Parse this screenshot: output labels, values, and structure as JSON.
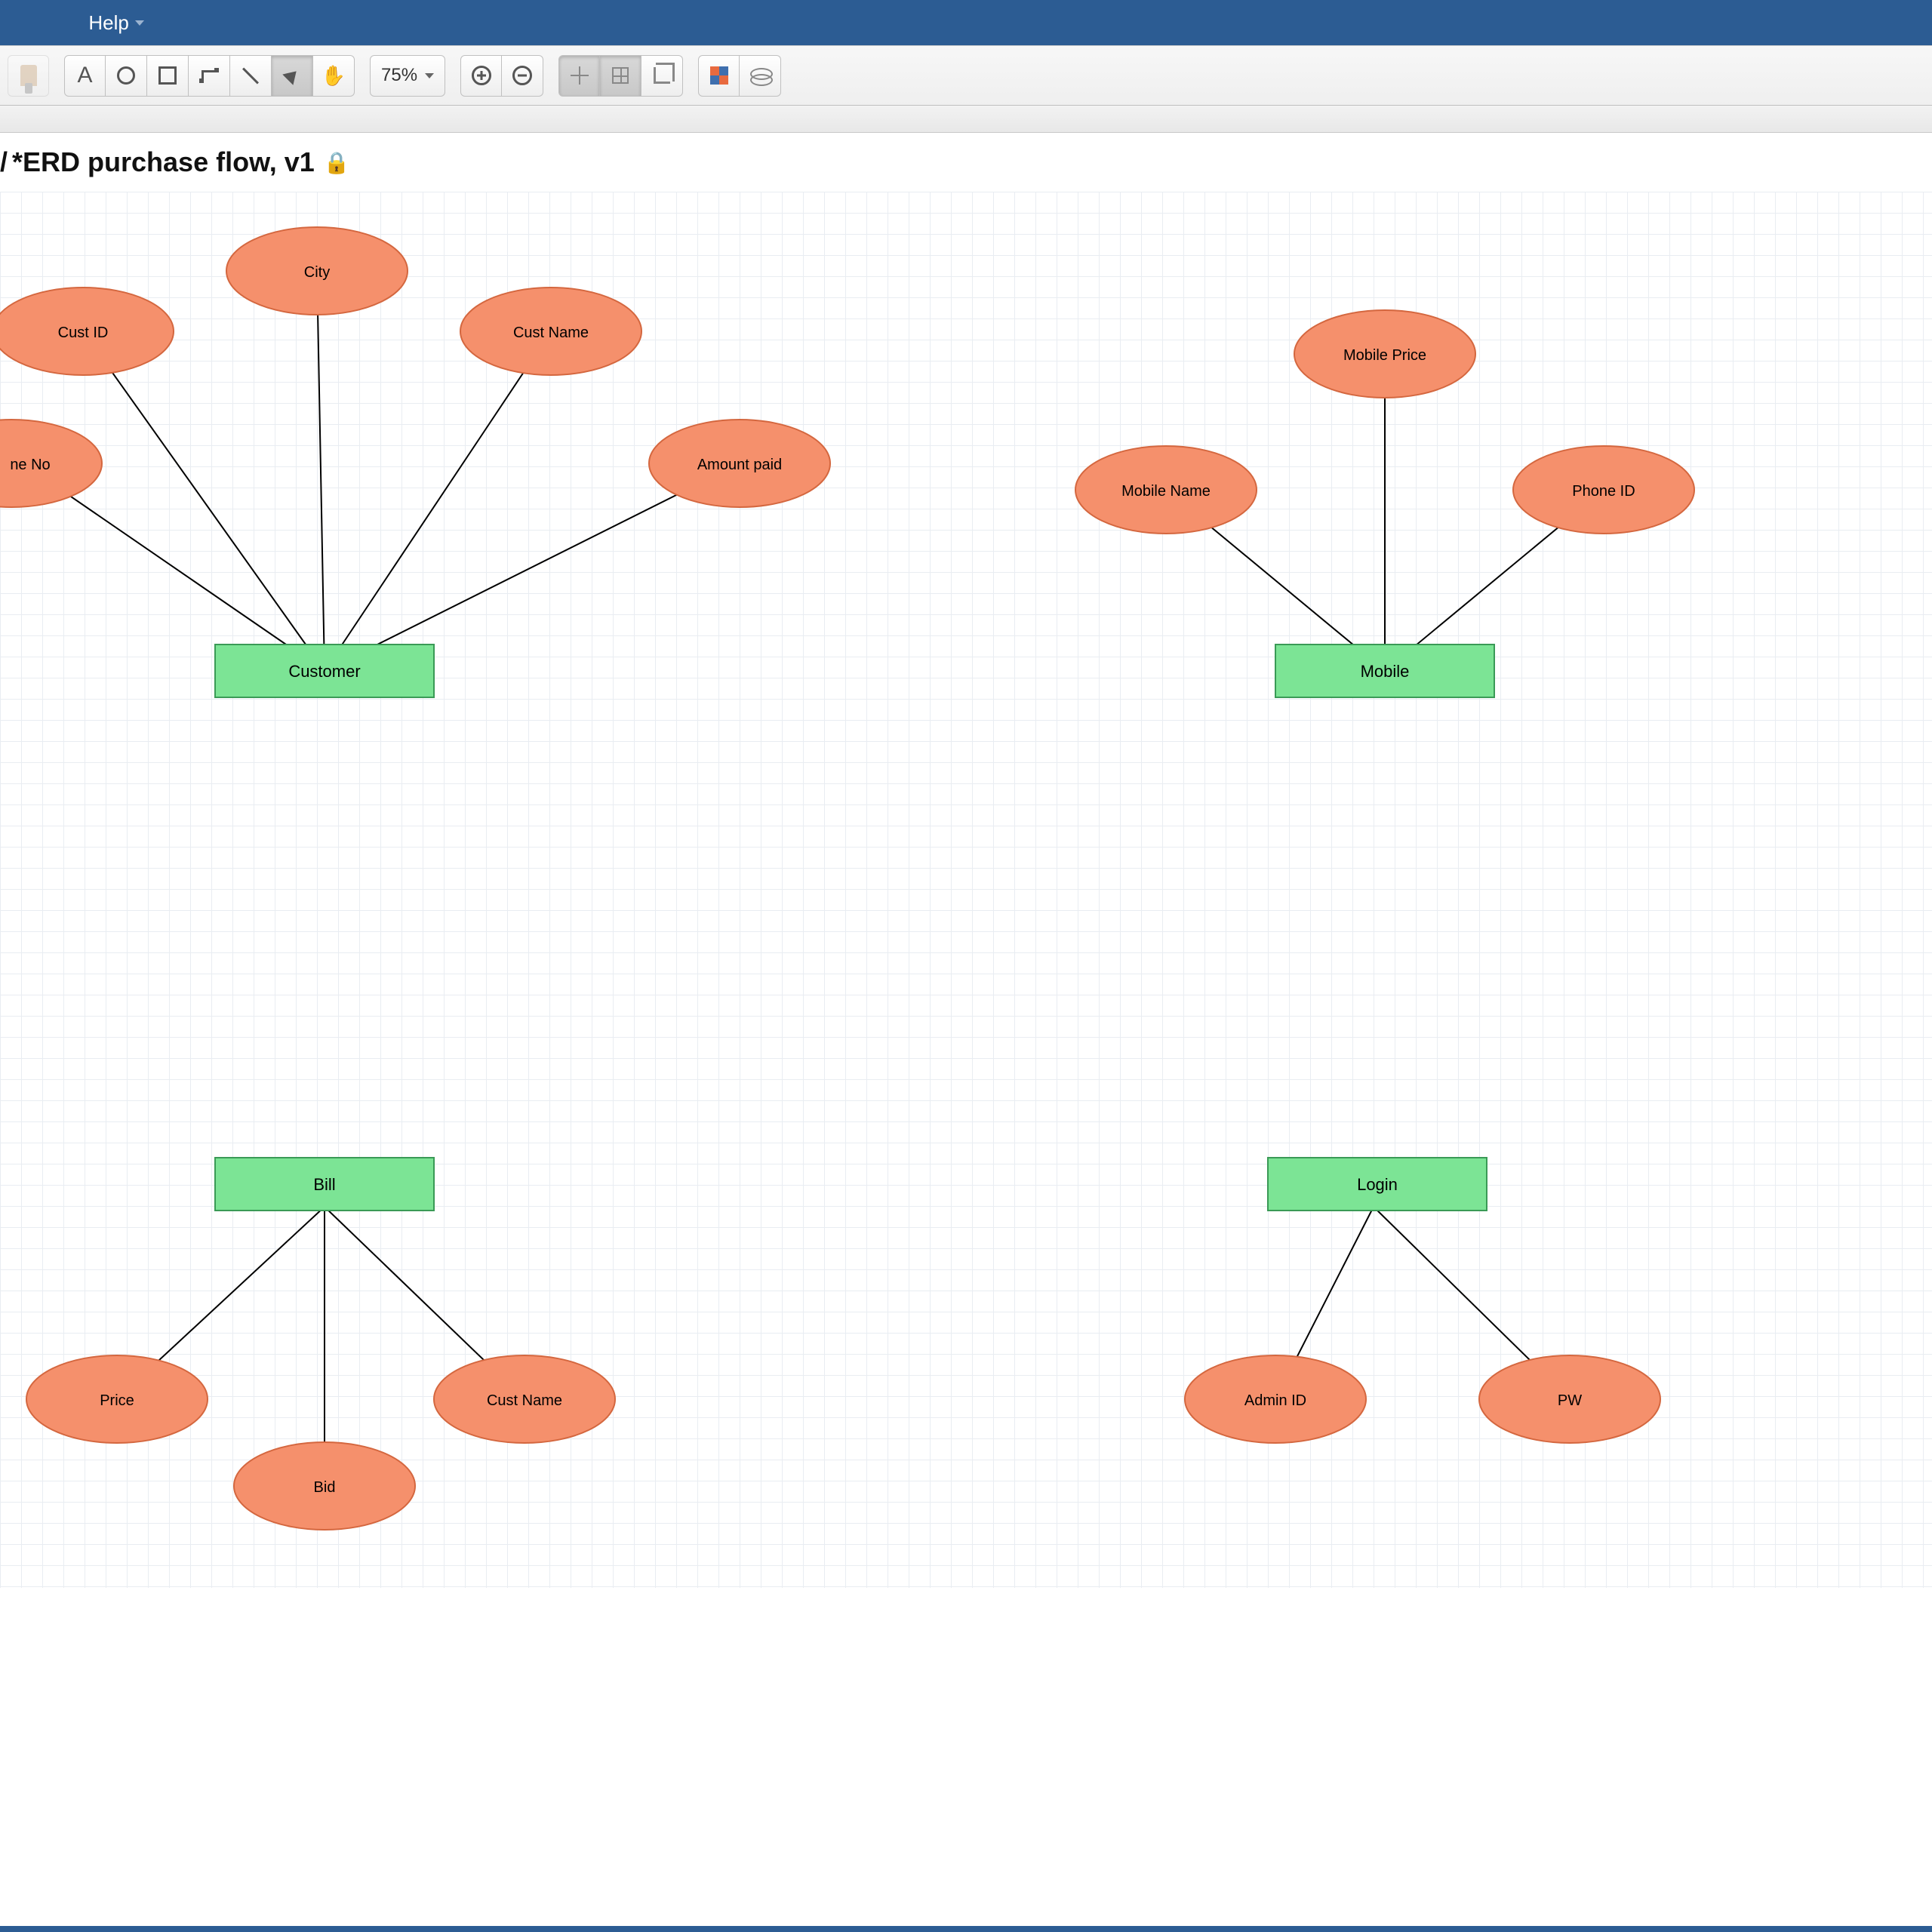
{
  "menu": {
    "help_label": "Help"
  },
  "toolbar": {
    "zoom_label": "75%"
  },
  "doc": {
    "breadcrumb_sep": "/",
    "title": "*ERD purchase flow, v1"
  },
  "diagram": {
    "entities": {
      "customer": "Customer",
      "mobile": "Mobile",
      "bill": "Bill",
      "login": "Login"
    },
    "attributes": {
      "cust_id": "Cust ID",
      "city": "City",
      "cust_name": "Cust Name",
      "phone_no": "ne No",
      "amount_paid": "Amount paid",
      "mobile_name": "Mobile Name",
      "mobile_price": "Mobile Price",
      "phone_id": "Phone ID",
      "price": "Price",
      "bid": "Bid",
      "cust_name_b": "Cust Name",
      "admin_id": "Admin ID",
      "pw": "PW"
    }
  }
}
